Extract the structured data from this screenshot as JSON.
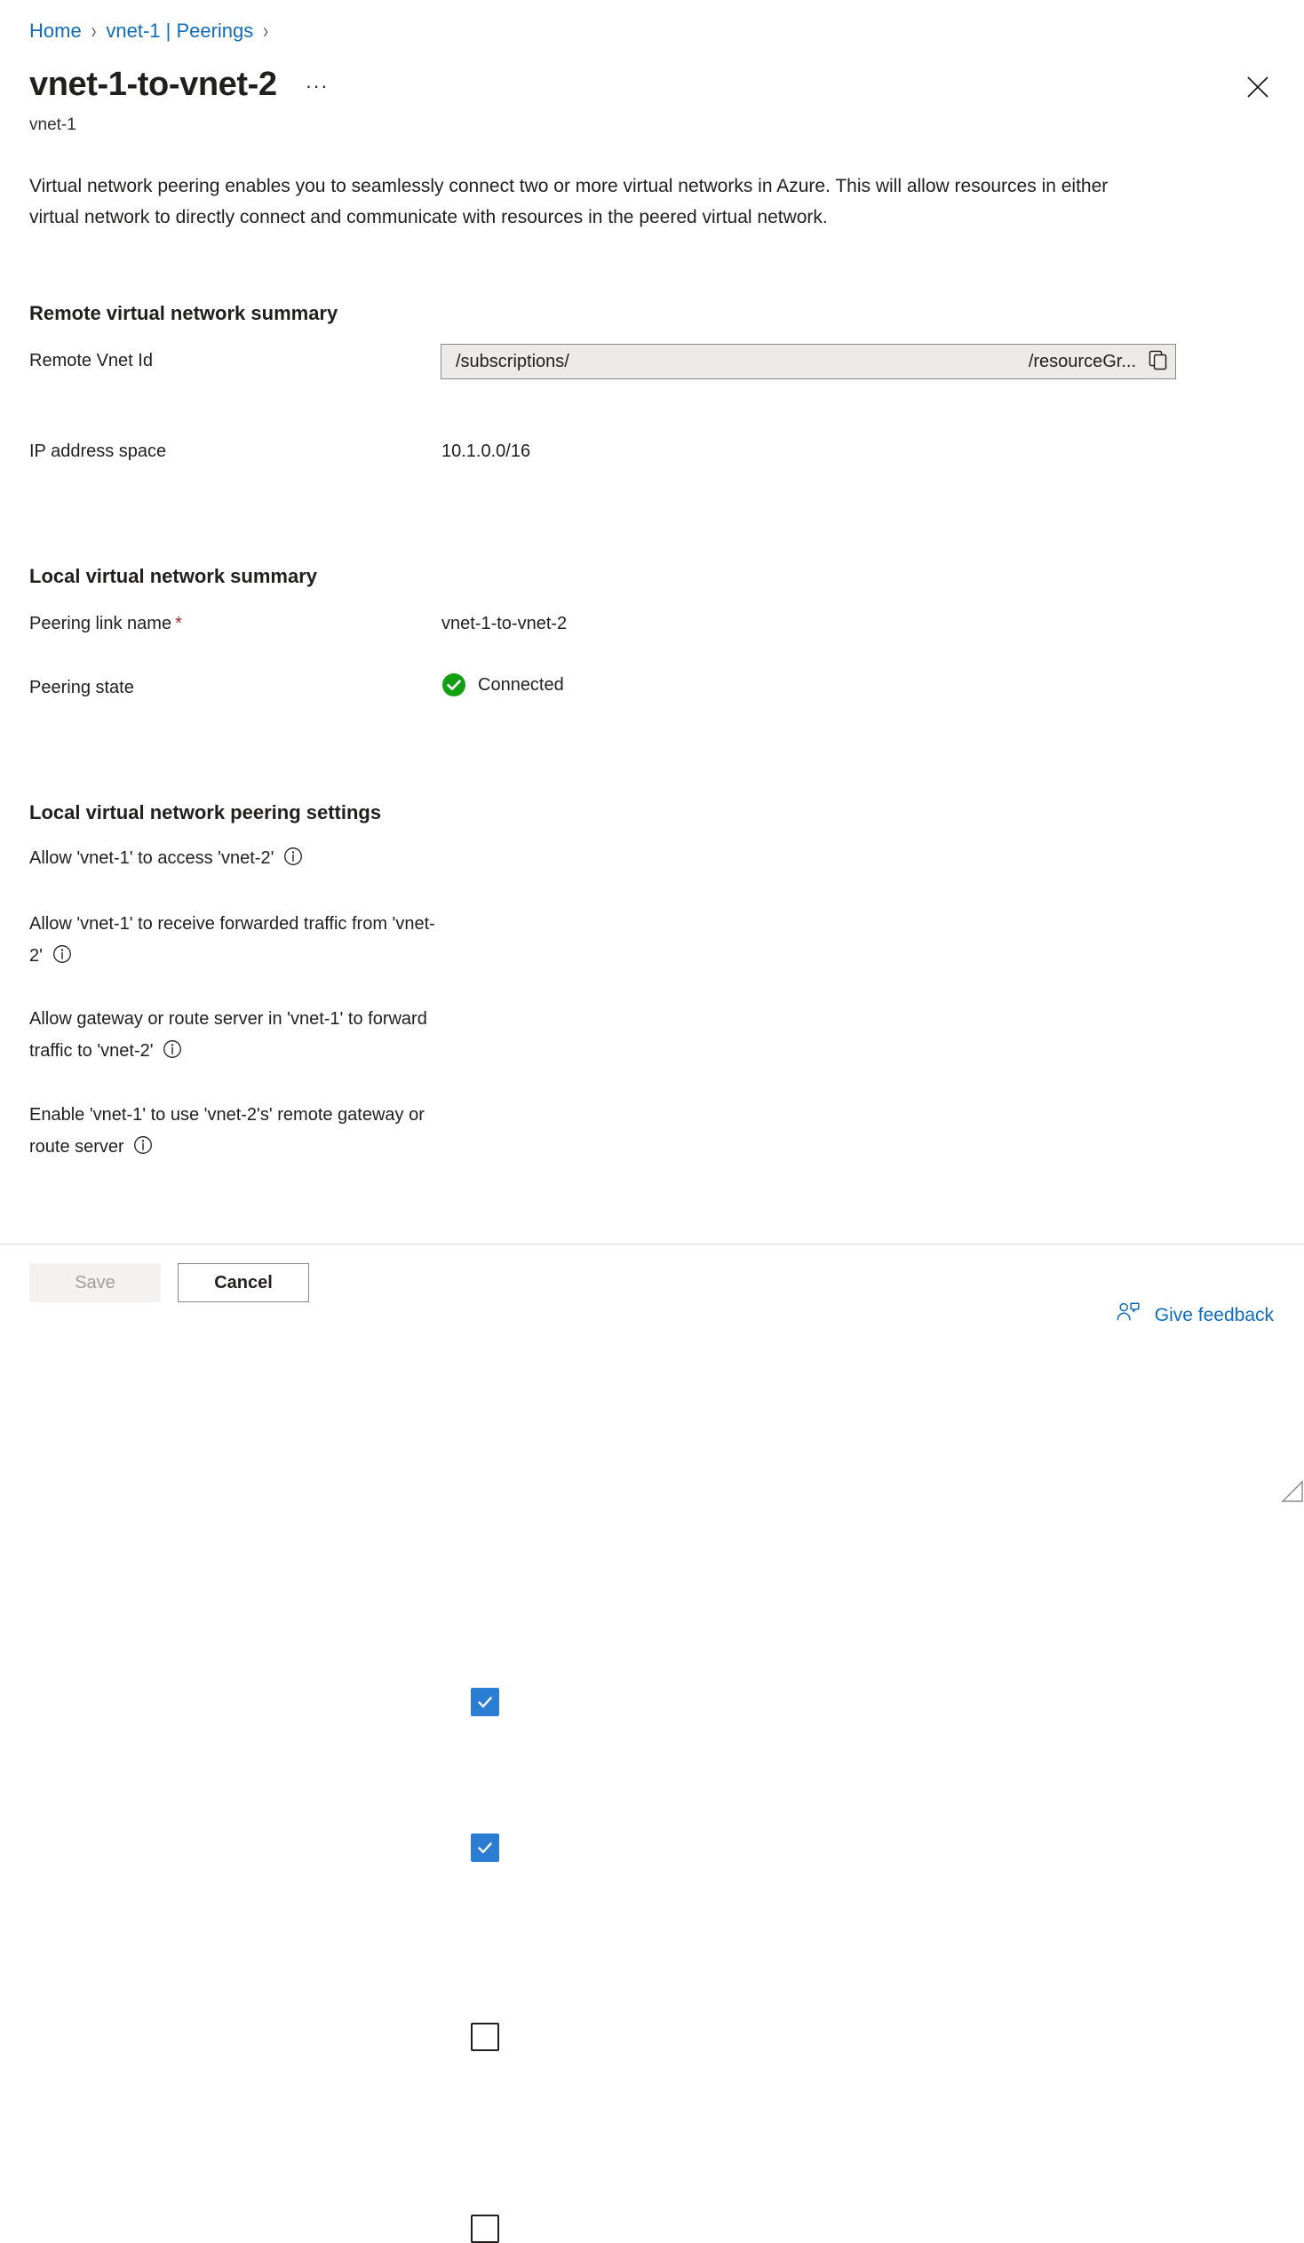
{
  "breadcrumb": {
    "items": [
      {
        "label": "Home"
      },
      {
        "label": "vnet-1 | Peerings"
      }
    ],
    "separator": "›"
  },
  "header": {
    "title": "vnet-1-to-vnet-2",
    "subtitle": "vnet-1",
    "more_label": "···",
    "close_icon": "close-icon"
  },
  "description": "Virtual network peering enables you to seamlessly connect two or more virtual networks in Azure. This will allow resources in either virtual network to directly connect and communicate with resources in the peered virtual network.",
  "remote_summary": {
    "heading": "Remote virtual network summary",
    "vnet_id_label": "Remote Vnet Id",
    "vnet_id_prefix": "/subscriptions/",
    "vnet_id_suffix": "/resourceGr...",
    "copy_icon": "copy-icon",
    "ip_space_label": "IP address space",
    "ip_space_value": "10.1.0.0/16"
  },
  "local_summary": {
    "heading": "Local virtual network summary",
    "link_name_label": "Peering link name",
    "required_marker": "*",
    "link_name_value": "vnet-1-to-vnet-2",
    "state_label": "Peering state",
    "state_value": "Connected",
    "state_icon": "check-circle-icon",
    "state_color": "#107c10"
  },
  "settings": {
    "heading": "Local virtual network peering settings",
    "checkbox_color": "#2b7cd3",
    "items": [
      {
        "label": "Allow 'vnet-1' to access 'vnet-2'",
        "checked": true,
        "info_icon": "info-icon"
      },
      {
        "label": "Allow 'vnet-1' to receive forwarded traffic from 'vnet-2'",
        "checked": true,
        "info_icon": "info-icon"
      },
      {
        "label": "Allow gateway or route server in 'vnet-1' to forward traffic to 'vnet-2'",
        "checked": false,
        "info_icon": "info-icon"
      },
      {
        "label": "Enable 'vnet-1' to use 'vnet-2's' remote gateway or route server",
        "checked": false,
        "info_icon": "info-icon"
      }
    ]
  },
  "footer": {
    "save_label": "Save",
    "cancel_label": "Cancel",
    "feedback_label": "Give feedback",
    "feedback_icon": "feedback-person-icon",
    "link_color": "#0f6cbd"
  }
}
